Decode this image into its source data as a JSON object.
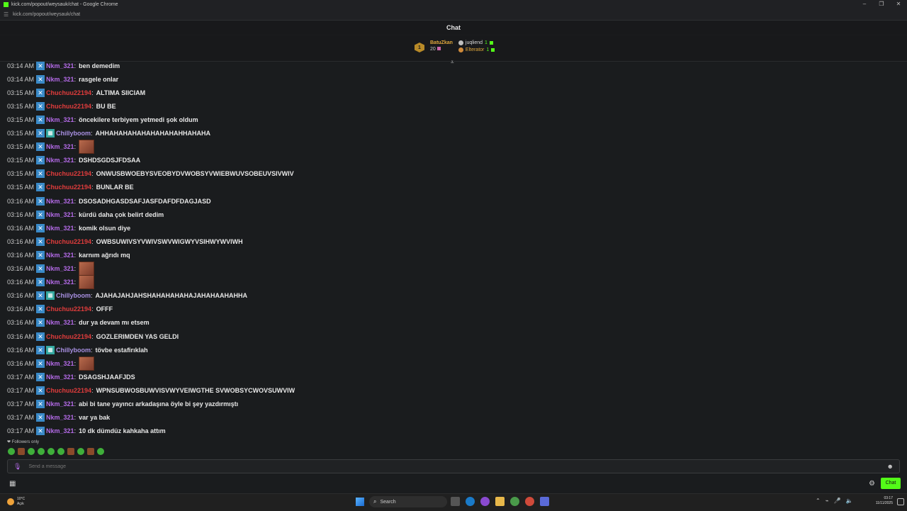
{
  "browser": {
    "window_title": "kick.com/popout/weysauk/chat - Google Chrome",
    "url": "kick.com/popout/weysauk/chat",
    "controls": {
      "minimize": "–",
      "restore": "❐",
      "close": "✕"
    }
  },
  "header": {
    "title": "Chat"
  },
  "leaderboard": {
    "first": {
      "rank": "1",
      "name": "BatuZkan",
      "count": "20"
    },
    "second": {
      "name": "juqliend",
      "count": "1"
    },
    "third": {
      "name": "Elterator",
      "count": "1"
    }
  },
  "messages": [
    {
      "time": "03:14 AM",
      "user": "Nkm_321",
      "kind": "nkm",
      "text": "ben demedim"
    },
    {
      "time": "03:14 AM",
      "user": "Nkm_321",
      "kind": "nkm",
      "text": "rasgele onlar"
    },
    {
      "time": "03:15 AM",
      "user": "Chuchuu22194",
      "kind": "chu",
      "text": "ALTIMA SIICIAM"
    },
    {
      "time": "03:15 AM",
      "user": "Chuchuu22194",
      "kind": "chu",
      "text": "BU BE"
    },
    {
      "time": "03:15 AM",
      "user": "Nkm_321",
      "kind": "nkm",
      "text": "öncekilere terbiyem yetmedi şok oldum"
    },
    {
      "time": "03:15 AM",
      "user": "Chillyboom",
      "kind": "chi",
      "text": "AHHAHAHAHAHAHAHAHAHHAHAHA"
    },
    {
      "time": "03:15 AM",
      "user": "Nkm_321",
      "kind": "nkm",
      "text": "",
      "emote": true
    },
    {
      "time": "03:15 AM",
      "user": "Nkm_321",
      "kind": "nkm",
      "text": "DSHDSGDSJFDSAA"
    },
    {
      "time": "03:15 AM",
      "user": "Chuchuu22194",
      "kind": "chu",
      "text": "ONWUSBWOEBYSVEOBYDVWOBSYVWIEBWUVSOBEUVSIVWIV"
    },
    {
      "time": "03:15 AM",
      "user": "Chuchuu22194",
      "kind": "chu",
      "text": "BUNLAR BE"
    },
    {
      "time": "03:16 AM",
      "user": "Nkm_321",
      "kind": "nkm",
      "text": "DSOSADHGASDSAFJASFDAFDFDAGJASD"
    },
    {
      "time": "03:16 AM",
      "user": "Nkm_321",
      "kind": "nkm",
      "text": "kürdü daha çok belirt dedim"
    },
    {
      "time": "03:16 AM",
      "user": "Nkm_321",
      "kind": "nkm",
      "text": "komik olsun diye"
    },
    {
      "time": "03:16 AM",
      "user": "Chuchuu22194",
      "kind": "chu",
      "text": "OWBSUWIVSYVWIVSWVWIGWYVSIHWYWVIWH"
    },
    {
      "time": "03:16 AM",
      "user": "Nkm_321",
      "kind": "nkm",
      "text": "karnım ağrıdı mq"
    },
    {
      "time": "03:16 AM",
      "user": "Nkm_321",
      "kind": "nkm",
      "text": "",
      "emote": true
    },
    {
      "time": "03:16 AM",
      "user": "Nkm_321",
      "kind": "nkm",
      "text": "",
      "emote": true
    },
    {
      "time": "03:16 AM",
      "user": "Chillyboom",
      "kind": "chi",
      "text": "AJAHAJAHJAHSHAHAHAHAHAJAHAHAAHAHHA"
    },
    {
      "time": "03:16 AM",
      "user": "Chuchuu22194",
      "kind": "chu",
      "text": "OFFF"
    },
    {
      "time": "03:16 AM",
      "user": "Nkm_321",
      "kind": "nkm",
      "text": "dur ya devam mı etsem"
    },
    {
      "time": "03:16 AM",
      "user": "Chuchuu22194",
      "kind": "chu",
      "text": "GOZLERIMDEN YAS GELDI"
    },
    {
      "time": "03:16 AM",
      "user": "Chillyboom",
      "kind": "chi",
      "text": "tövbe estafirıklah"
    },
    {
      "time": "03:16 AM",
      "user": "Nkm_321",
      "kind": "nkm",
      "text": "",
      "emote": true
    },
    {
      "time": "03:17 AM",
      "user": "Nkm_321",
      "kind": "nkm",
      "text": "DSAGSHJAAFJDS"
    },
    {
      "time": "03:17 AM",
      "user": "Chuchuu22194",
      "kind": "chu",
      "text": "WPNSUBWOSBUWVISVWYVEIWGTHE SVWOBSYCWOVSUWVIW"
    },
    {
      "time": "03:17 AM",
      "user": "Nkm_321",
      "kind": "nkm",
      "text": "abi bi tane yayıncı arkadaşına öyle bi şey yazdırmıştı"
    },
    {
      "time": "03:17 AM",
      "user": "Nkm_321",
      "kind": "nkm",
      "text": "var ya bak"
    },
    {
      "time": "03:17 AM",
      "user": "Nkm_321",
      "kind": "nkm",
      "text": "10 dk dümdüz kahkaha attım"
    }
  ],
  "footer": {
    "followers_only": "❤ Followers only",
    "input_placeholder": "Send a message",
    "chat_button": "Chat"
  },
  "taskbar": {
    "weather_temp": "10°C",
    "weather_desc": "Açık",
    "search_label": "Search",
    "time": "03:17",
    "date": "11/11/2025"
  },
  "icons": {
    "mod_badge": "✕",
    "sub_badge": "▦",
    "mic": "🎙",
    "emoji": "☻",
    "calendar": "▦",
    "gear": "⚙",
    "site_info": "☰",
    "search": "⌕",
    "scroll_down": "⩡",
    "tray_up": "⌃",
    "tray_net": "⌁",
    "tray_vol": "🔈",
    "tray_mic": "🎤"
  },
  "colors": {
    "accent": "#53fc18",
    "user_nkm": "#b36ae6",
    "user_chu": "#e03c3c",
    "user_chi": "#a78fe0"
  }
}
